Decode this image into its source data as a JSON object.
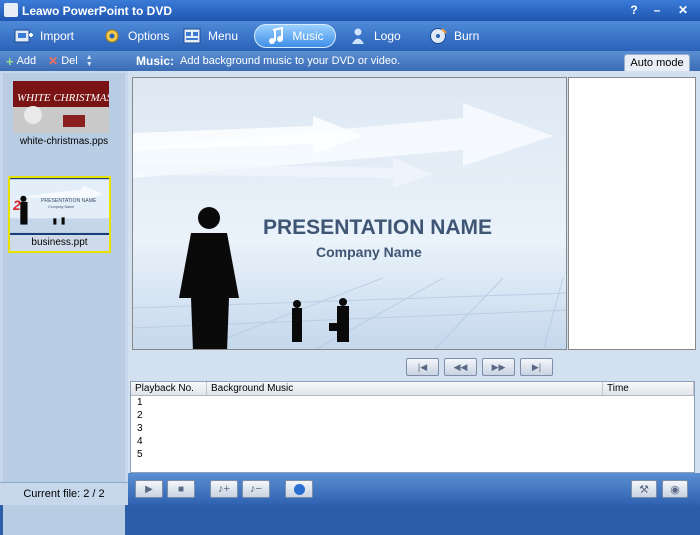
{
  "window": {
    "title": "Leawo PowerPoint to DVD",
    "help": "?",
    "minimize": "–",
    "close": "✕"
  },
  "toolbar": {
    "items": [
      {
        "label": "Import",
        "icon": "import-icon"
      },
      {
        "label": "Options",
        "icon": "gear-icon"
      },
      {
        "label": "Menu",
        "icon": "menu-icon"
      },
      {
        "label": "Music",
        "icon": "music-icon",
        "active": true
      },
      {
        "label": "Logo",
        "icon": "logo-icon"
      },
      {
        "label": "Burn",
        "icon": "burn-icon"
      }
    ]
  },
  "sidebar": {
    "add_label": "Add",
    "del_label": "Del",
    "files": [
      {
        "name": "white-christmas.pps",
        "number": ""
      },
      {
        "name": "business.ppt",
        "number": "2"
      }
    ],
    "current_file": "Current file: 2 / 2"
  },
  "music": {
    "heading": "Music:",
    "description": "Add background music to your DVD or video.",
    "auto_mode": "Auto mode"
  },
  "slide": {
    "title": "PRESENTATION  NAME",
    "subtitle": "Company Name",
    "thumb1_text": "WHITE CHRISTMAS",
    "thumb2_title": "PRESENTATION NAME",
    "thumb2_sub": "Company Name"
  },
  "table": {
    "headers": [
      "Playback No.",
      "Background Music",
      "Time"
    ],
    "rows": [
      "1",
      "2",
      "3",
      "4",
      "5"
    ]
  },
  "colors": {
    "accent": "#2b5ea8",
    "selection": "#e8e200"
  }
}
